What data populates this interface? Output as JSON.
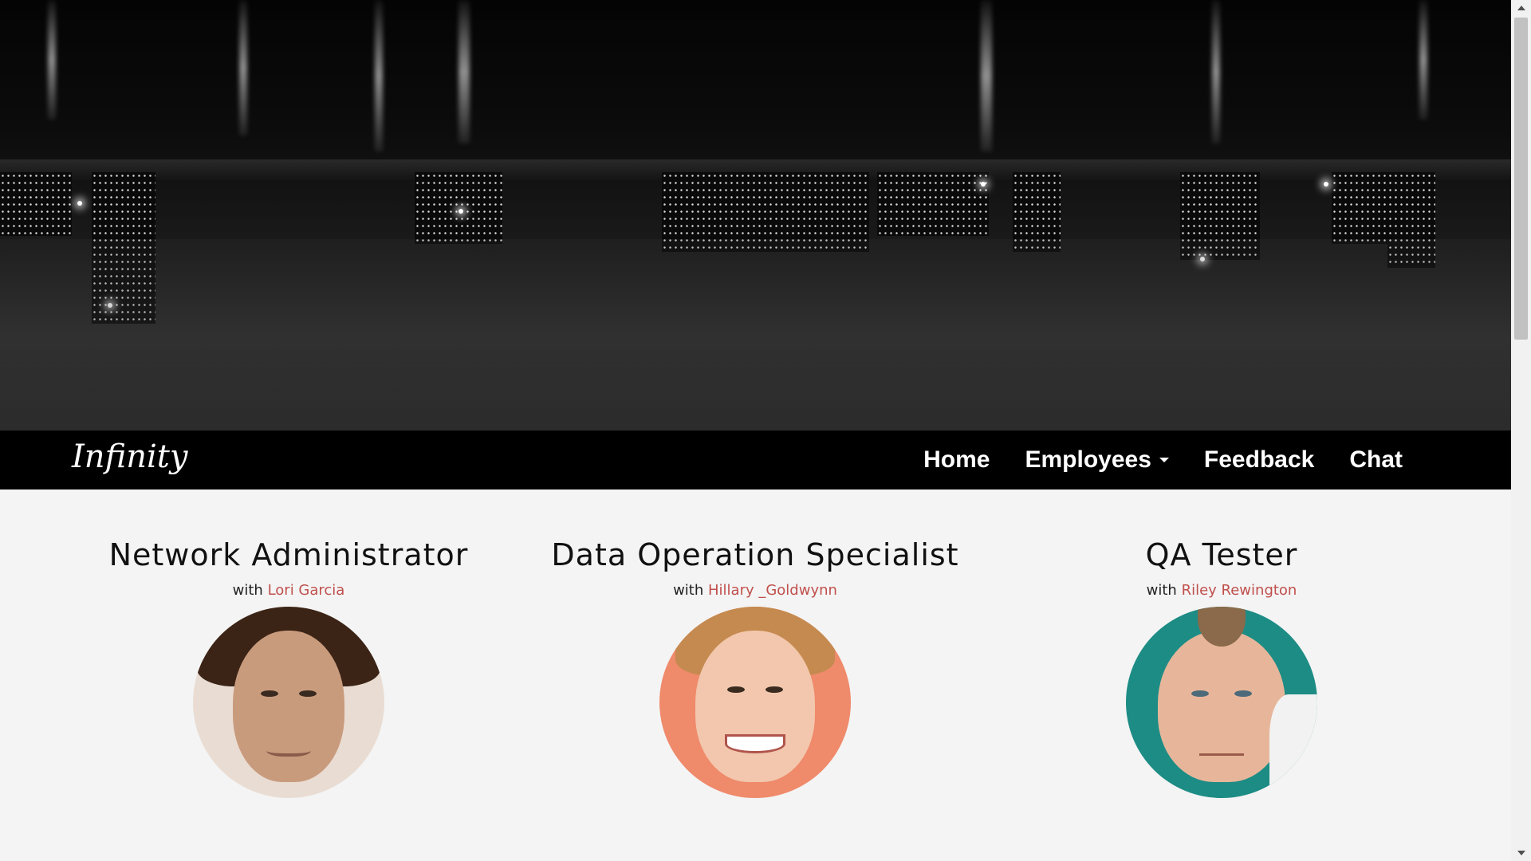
{
  "navbar": {
    "brand": "Infinity",
    "items": [
      {
        "label": "Home"
      },
      {
        "label": "Employees"
      },
      {
        "label": "Feedback"
      },
      {
        "label": "Chat"
      }
    ]
  },
  "cards": [
    {
      "title": "Network Administrator",
      "with_label": "with",
      "person": "Lori Garcia"
    },
    {
      "title": "Data Operation Specialist",
      "with_label": "with",
      "person": "Hillary _Goldwynn"
    },
    {
      "title": "QA Tester",
      "with_label": "with",
      "person": "Riley Rewington"
    }
  ],
  "colors": {
    "navbar_bg": "#000000",
    "page_bg": "#f4f4f4",
    "person_link": "#c0504d"
  },
  "icons": {
    "dropdown": "caret-down-icon",
    "scroll_up": "scroll-up-arrow-icon",
    "scroll_down": "scroll-down-arrow-icon"
  }
}
